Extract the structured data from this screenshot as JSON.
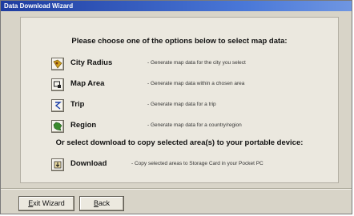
{
  "window": {
    "title": "Data Download Wizard"
  },
  "panel": {
    "heading": "Please choose one of the options below to select map data:",
    "options": [
      {
        "label": "City Radius",
        "description": "- Generate map data for the city you select",
        "icon": "city-pin-icon",
        "icon_color": "#d2a21c"
      },
      {
        "label": "Map Area",
        "description": "- Generate map data within a chosen area",
        "icon": "map-area-icon",
        "icon_color": "#222222"
      },
      {
        "label": "Trip",
        "description": "- Generate map data for a trip",
        "icon": "trip-route-icon",
        "icon_color": "#1a3ea8"
      },
      {
        "label": "Region",
        "description": "- Generate map data for a country/region",
        "icon": "region-map-icon",
        "icon_color": "#3a8a2e"
      }
    ],
    "subheading": "Or select download to copy selected area(s) to your portable device:",
    "download": {
      "label": "Download",
      "description": "- Copy selected areas to Storage Card in your Pocket PC",
      "icon": "download-icon"
    }
  },
  "footer": {
    "exit_label_first": "E",
    "exit_label_rest": "xit Wizard",
    "back_label_first": "B",
    "back_label_rest": "ack"
  }
}
